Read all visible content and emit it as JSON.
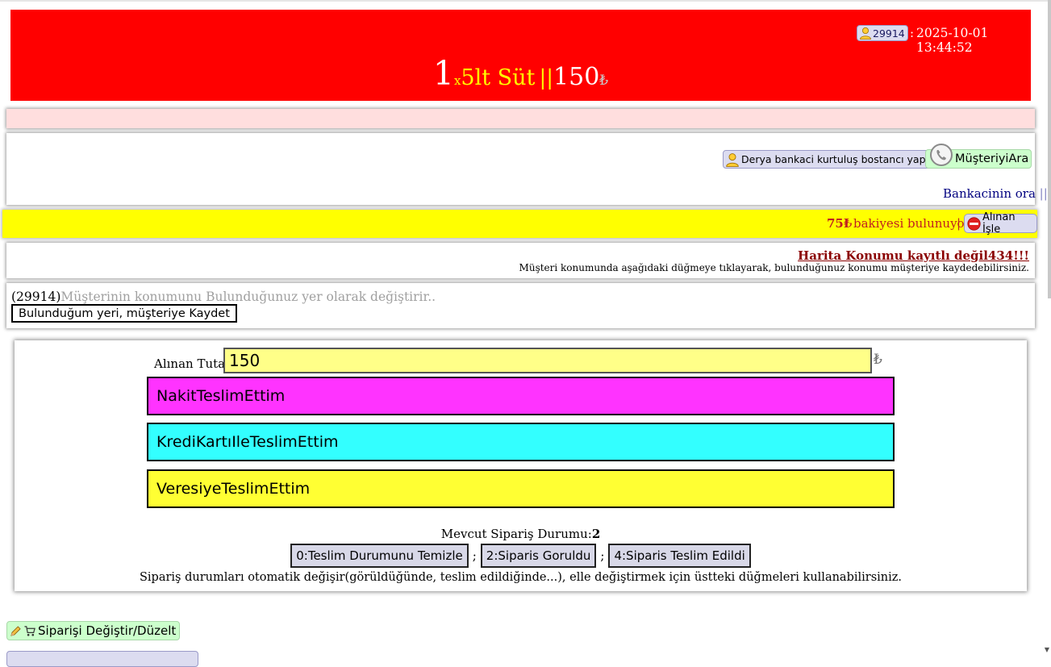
{
  "header": {
    "user_id": "29914",
    "separator": ":",
    "datetime": "2025-10-01 13:44:52",
    "quantity": "1",
    "times": "x",
    "product": "5lt Süt",
    "divider": "||",
    "price": "150",
    "currency": "₺"
  },
  "customer": {
    "address_button": "Derya bankaci kurtuluş bostancı yapi",
    "call_button": "MüşteriyiAra",
    "note": "Bankacinin ora",
    "note_bar": "||"
  },
  "balance": {
    "amount": "75₺",
    "text": "bakiyesi bulunuyor",
    "separator": "|",
    "apply_button": "Alınan İşle"
  },
  "map_warning": {
    "title": "Harita Konumu kayıtlı değil434!!!",
    "description": "Müşteri konumunda aşağıdaki düğmeye tıklayarak, bulunduğunuz konumu müşteriye kaydedebilirsiniz."
  },
  "location": {
    "customer_id": "(29914)",
    "hint": "Müşterinin konumunu Bulunduğunuz yer olarak değiştirir..",
    "save_button": "Bulunduğum yeri, müşteriye Kaydet"
  },
  "delivery": {
    "amount_label": "Alınan Tutar:",
    "amount_value": "150",
    "currency": "₺",
    "cash_button": "NakitTeslimEttim",
    "card_button": "KrediKartıIleTeslimEttim",
    "credit_button": "VeresiyeTeslimEttim",
    "status_label": "Mevcut Sipariş Durumu:",
    "status_value": "2",
    "status_buttons": [
      "0:Teslim Durumunu Temizle",
      "2:Siparis Goruldu",
      "4:Siparis Teslim Edildi"
    ],
    "status_separator": ";",
    "status_note": "Sipariş durumları otomatik değişir(görüldüğünde, teslim edildiğinde...), elle değiştirmek için üstteki düğmeleri kullanabilirsiniz."
  },
  "actions": {
    "edit_order_button": "Siparişi Değiştir/Düzelt"
  },
  "icons": {
    "user": "user-icon",
    "phone": "phone-icon",
    "no_entry": "no-entry-icon",
    "pencil": "pencil-icon",
    "cart": "cart-icon"
  },
  "colors": {
    "header_bg": "#ff0000",
    "balance_bg": "#ffff00",
    "cash_bg": "#ff33ff",
    "card_bg": "#33ffff",
    "credit_bg": "#ffff33",
    "amount_input_bg": "#ffff88"
  }
}
